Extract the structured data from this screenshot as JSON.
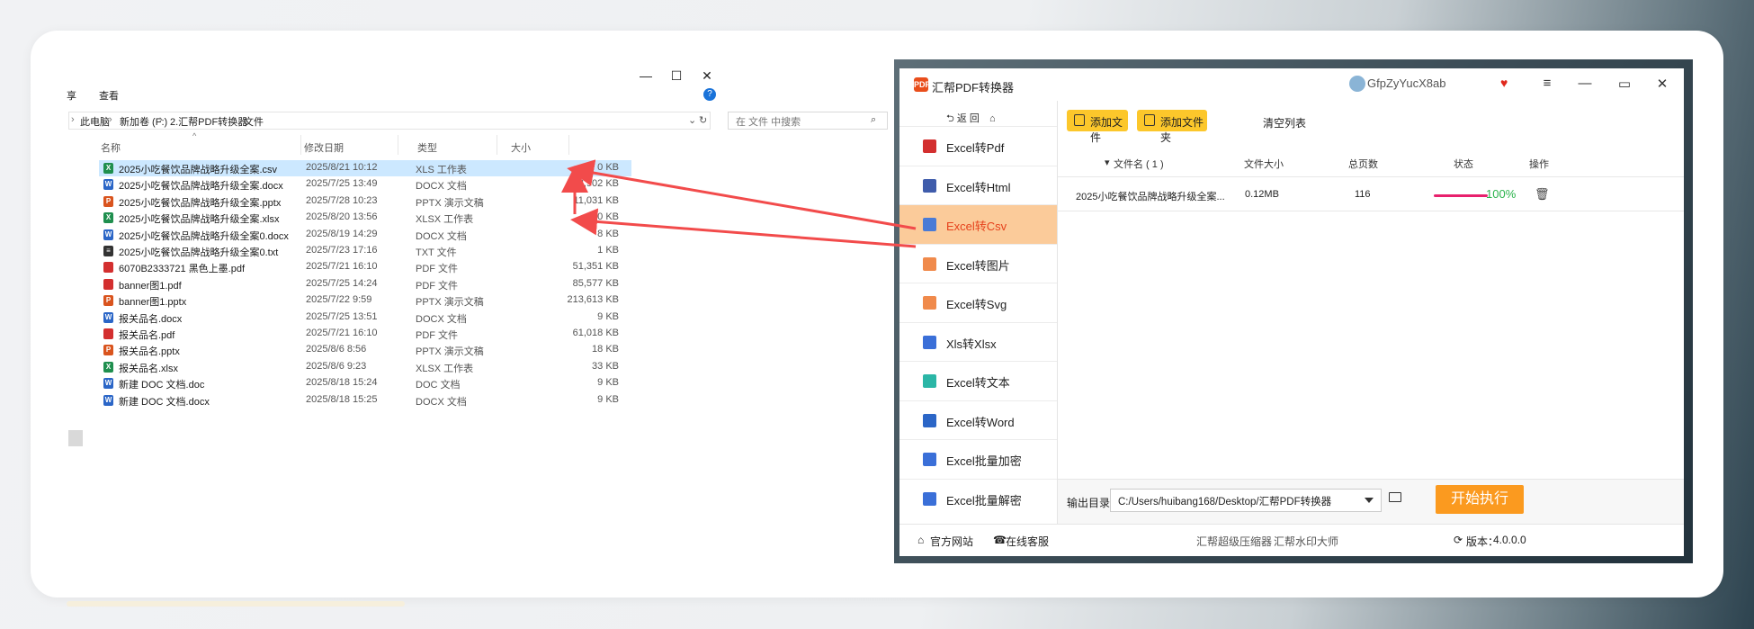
{
  "explorer": {
    "controls": {
      "minimize": "—",
      "maximize": "☐",
      "close": "✕"
    },
    "ribbon": {
      "share": "享",
      "view": "查看"
    },
    "address": {
      "this_pc": "此电脑",
      "drive": "新加卷 (F:)",
      "folder": "2.汇帮PDF转换器",
      "sub": "文件"
    },
    "search_placeholder": "在 文件 中搜索",
    "columns": {
      "name": "名称",
      "date": "修改日期",
      "type": "类型",
      "size": "大小"
    },
    "files": [
      {
        "name": "2025小吃餐饮品牌战略升级全案.csv",
        "date": "2025/8/21 10:12",
        "type": "XLS 工作表",
        "size": "0 KB",
        "icon": "xls"
      },
      {
        "name": "2025小吃餐饮品牌战略升级全案.docx",
        "date": "2025/7/25 13:49",
        "type": "DOCX 文档",
        "size": "18,902 KB",
        "icon": "doc"
      },
      {
        "name": "2025小吃餐饮品牌战略升级全案.pptx",
        "date": "2025/7/28 10:23",
        "type": "PPTX 演示文稿",
        "size": "11,031 KB",
        "icon": "ppt"
      },
      {
        "name": "2025小吃餐饮品牌战略升级全案.xlsx",
        "date": "2025/8/20 13:56",
        "type": "XLSX 工作表",
        "size": "120 KB",
        "icon": "xls"
      },
      {
        "name": "2025小吃餐饮品牌战略升级全案0.docx",
        "date": "2025/8/19 14:29",
        "type": "DOCX 文档",
        "size": "8 KB",
        "icon": "doc"
      },
      {
        "name": "2025小吃餐饮品牌战略升级全案0.txt",
        "date": "2025/7/23 17:16",
        "type": "TXT 文件",
        "size": "1 KB",
        "icon": "txt"
      },
      {
        "name": "6070B2333721 黑色上墨.pdf",
        "date": "2025/7/21 16:10",
        "type": "PDF 文件",
        "size": "51,351 KB",
        "icon": "pdf"
      },
      {
        "name": "banner图1.pdf",
        "date": "2025/7/25 14:24",
        "type": "PDF 文件",
        "size": "85,577 KB",
        "icon": "pdf"
      },
      {
        "name": "banner图1.pptx",
        "date": "2025/7/22 9:59",
        "type": "PPTX 演示文稿",
        "size": "213,613 KB",
        "icon": "ppt"
      },
      {
        "name": "报关品名.docx",
        "date": "2025/7/25 13:51",
        "type": "DOCX 文档",
        "size": "9 KB",
        "icon": "doc"
      },
      {
        "name": "报关品名.pdf",
        "date": "2025/7/21 16:10",
        "type": "PDF 文件",
        "size": "61,018 KB",
        "icon": "pdf"
      },
      {
        "name": "报关品名.pptx",
        "date": "2025/8/6 8:56",
        "type": "PPTX 演示文稿",
        "size": "18 KB",
        "icon": "ppt"
      },
      {
        "name": "报关品名.xlsx",
        "date": "2025/8/6 9:23",
        "type": "XLSX 工作表",
        "size": "33 KB",
        "icon": "xls"
      },
      {
        "name": "新建 DOC 文档.doc",
        "date": "2025/8/18 15:24",
        "type": "DOC 文档",
        "size": "9 KB",
        "icon": "doc"
      },
      {
        "name": "新建 DOC 文档.docx",
        "date": "2025/8/18 15:25",
        "type": "DOCX 文档",
        "size": "9 KB",
        "icon": "doc"
      }
    ]
  },
  "icon_colors": {
    "xls": "#1f8f4e",
    "doc": "#2b66c7",
    "ppt": "#d9541e",
    "pdf": "#d32f2f",
    "txt": "#333333"
  },
  "app": {
    "title": "汇帮PDF转换器",
    "logo_text": "PDF",
    "user": "GfpZyYucX8ab",
    "back_label": "返 回",
    "nav": [
      {
        "label": "Excel转Pdf",
        "color": "#d32f2f",
        "active": false
      },
      {
        "label": "Excel转Html",
        "color": "#3f5cab",
        "active": false
      },
      {
        "label": "Excel转Csv",
        "color": "#4a7bd6",
        "active": true
      },
      {
        "label": "Excel转图片",
        "color": "#f08a4b",
        "active": false
      },
      {
        "label": "Excel转Svg",
        "color": "#f08a4b",
        "active": false
      },
      {
        "label": "Xls转Xlsx",
        "color": "#3a6fd8",
        "active": false
      },
      {
        "label": "Excel转文本",
        "color": "#2bb6a6",
        "active": false
      },
      {
        "label": "Excel转Word",
        "color": "#2b66c7",
        "active": false
      },
      {
        "label": "Excel批量加密",
        "color": "#3a6fd8",
        "active": false
      },
      {
        "label": "Excel批量解密",
        "color": "#3a6fd8",
        "active": false
      }
    ],
    "toolbar": {
      "add_file": "添加文件",
      "add_folder": "添加文件夹",
      "clear": "清空列表"
    },
    "table_headers": {
      "name": "文件名 ( 1 )",
      "size": "文件大小",
      "pages": "总页数",
      "status": "状态",
      "action": "操作"
    },
    "rows": [
      {
        "name": "2025小吃餐饮品牌战略升级全案...",
        "size": "0.12MB",
        "pages": "116",
        "progress": 1.0,
        "progress_text": "100%"
      }
    ],
    "output": {
      "label": "输出目录:",
      "path": "C:/Users/huibang168/Desktop/汇帮PDF转换器"
    },
    "start_button": "开始执行",
    "footer": {
      "website": "官方网站",
      "service": "在线客服",
      "compress": "汇帮超级压缩器",
      "watermark": "汇帮水印大师",
      "version_label": "版本：",
      "version": "4.0.0.0"
    }
  }
}
